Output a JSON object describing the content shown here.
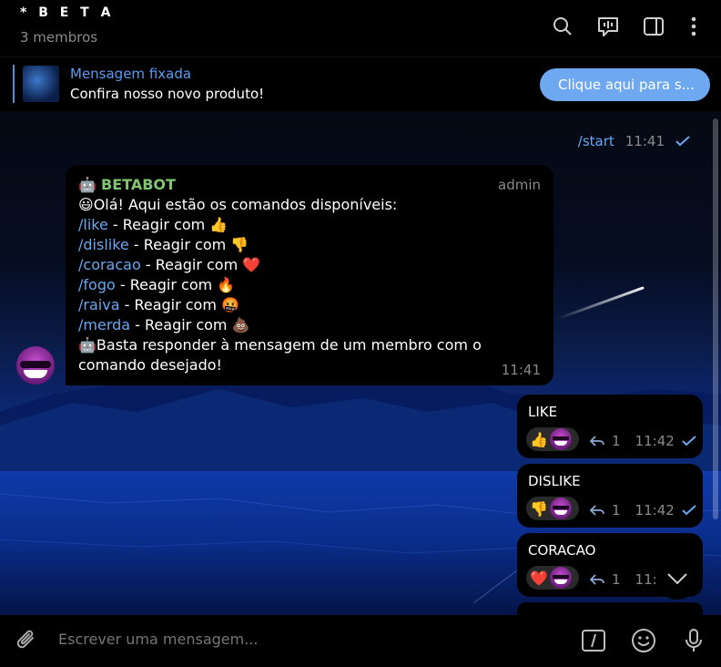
{
  "header": {
    "title": "* B E T A",
    "subtitle": "3 membros",
    "icons": [
      "search-icon",
      "voice-chat-icon",
      "sidebar-toggle-icon",
      "more-vertical-icon"
    ]
  },
  "pinned": {
    "label": "Mensagem fixada",
    "text": "Confira nosso novo produto!",
    "button_label": "Clique aqui para s..."
  },
  "messages": {
    "start": {
      "text": "/start",
      "time": "11:41"
    },
    "bot": {
      "sender": "BETABOT",
      "role": "admin",
      "intro": "Olá! Aqui estão os comandos disponíveis:",
      "commands": [
        {
          "cmd": "/like",
          "text": " - Reagir com ",
          "emoji": "👍"
        },
        {
          "cmd": "/dislike",
          "text": " - Reagir com ",
          "emoji": "👎"
        },
        {
          "cmd": "/coracao",
          "text": " - Reagir com ",
          "emoji": "❤️"
        },
        {
          "cmd": "/fogo",
          "text": " - Reagir com ",
          "emoji": "🔥"
        },
        {
          "cmd": "/raiva",
          "text": " - Reagir com ",
          "emoji": "🤬"
        },
        {
          "cmd": "/merda",
          "text": " - Reagir com ",
          "emoji": "💩"
        }
      ],
      "outro": "Basta responder à mensagem de um membro com o comando desejado!",
      "time": "11:41"
    },
    "reactions": [
      {
        "label": "LIKE",
        "emoji": "👍",
        "count": "1",
        "time": "11:42"
      },
      {
        "label": "DISLIKE",
        "emoji": "👎",
        "count": "1",
        "time": "11:42"
      },
      {
        "label": "CORACAO",
        "emoji": "❤️",
        "count": "1",
        "time": "11:4"
      }
    ]
  },
  "composer": {
    "placeholder": "Escrever uma mensagem...",
    "icons": [
      "attach-icon",
      "commands-icon",
      "emoji-icon",
      "microphone-icon"
    ]
  },
  "colors": {
    "link": "#6aa7f2",
    "accent": "#6ea8f0",
    "bot_name": "#7fc66e"
  }
}
